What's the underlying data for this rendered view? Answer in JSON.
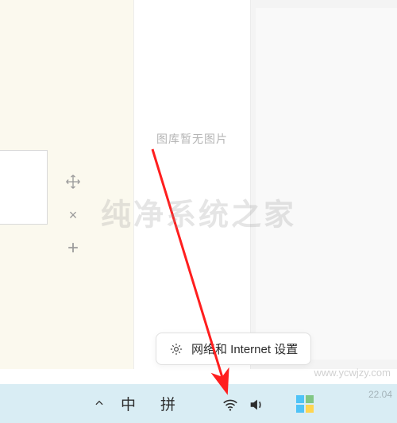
{
  "gallery": {
    "empty_label": "图库暂无图片"
  },
  "tooltip": {
    "label": "网络和 Internet 设置"
  },
  "taskbar": {
    "ime_mode": "中",
    "ime_method": "拼",
    "clock": "22.04"
  },
  "tools": {
    "move": "move-icon",
    "close": "×",
    "add": "+"
  },
  "watermark": {
    "brand": "纯净系统之家",
    "url": "www.ycwjzy.com"
  },
  "colors": {
    "arrow": "#ff1e1e",
    "taskbar": "#d9edf4"
  }
}
